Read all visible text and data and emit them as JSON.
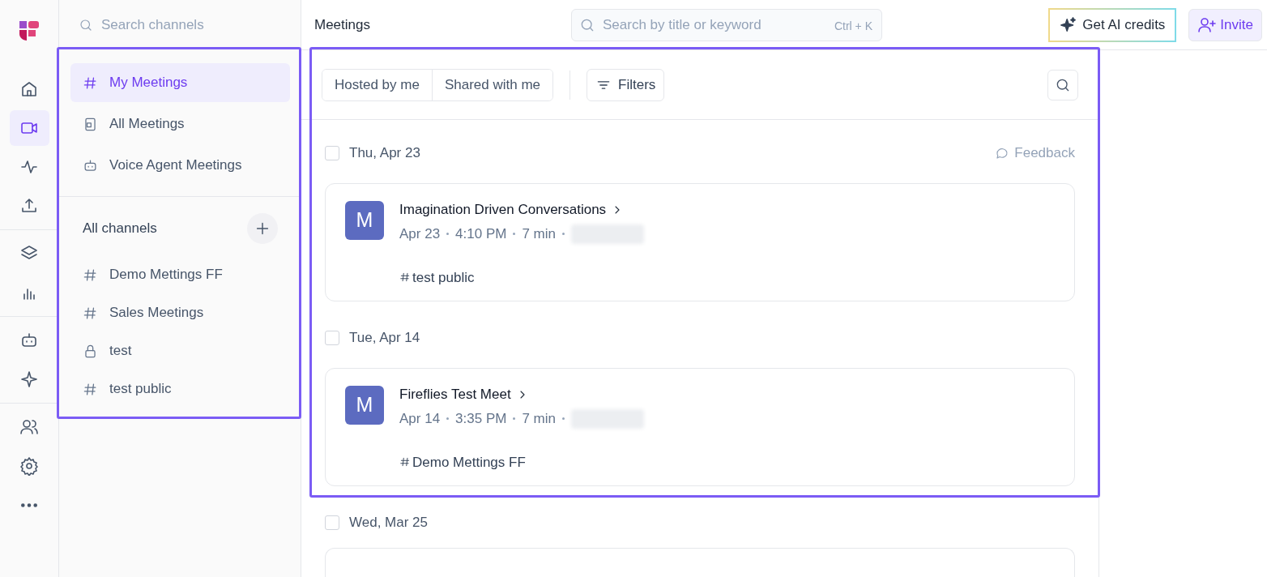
{
  "rail": [
    {
      "items": [
        {
          "kind": "home",
          "selected": false
        },
        {
          "kind": "video",
          "selected": true
        },
        {
          "kind": "activity",
          "selected": false
        },
        {
          "kind": "upload",
          "selected": false
        }
      ]
    },
    {
      "items": [
        {
          "kind": "layers",
          "selected": false
        },
        {
          "kind": "chart",
          "selected": false
        }
      ]
    },
    {
      "items": [
        {
          "kind": "bot",
          "selected": false
        },
        {
          "kind": "sparkle",
          "selected": false
        }
      ]
    },
    {
      "items": [
        {
          "kind": "users",
          "selected": false
        },
        {
          "kind": "gear",
          "selected": false
        },
        {
          "kind": "more",
          "selected": false
        }
      ]
    }
  ],
  "sidebar": {
    "search": {
      "placeholder": "Search channels"
    },
    "highlighted": true,
    "items": [
      {
        "label": "My Meetings",
        "kind": "hash",
        "selected": true
      },
      {
        "label": "All Meetings",
        "kind": "doc",
        "selected": false
      },
      {
        "label": "Voice Agent Meetings",
        "kind": "bot",
        "selected": false
      }
    ],
    "channels_heading": "All channels",
    "channels": [
      {
        "label": "Demo Mettings FF",
        "kind": "hash",
        "selected": false
      },
      {
        "label": "Sales Meetings",
        "kind": "hash",
        "selected": false
      },
      {
        "label": "test",
        "kind": "lock",
        "selected": false
      },
      {
        "label": "test public",
        "kind": "hash",
        "selected": false
      }
    ]
  },
  "header": {
    "title": "Meetings",
    "search": {
      "placeholder": "Search by title or keyword",
      "shortcut": "Ctrl + K"
    },
    "credits_button": "Get AI credits",
    "invite_button": "Invite"
  },
  "meetings": {
    "highlighted": true,
    "tabs": [
      {
        "label": "Hosted by me",
        "selected": false
      },
      {
        "label": "Shared with me",
        "selected": false
      }
    ],
    "filters_button": "Filters",
    "feedback": "Feedback",
    "groups": [
      {
        "date": "Thu, Apr 23",
        "checked": false,
        "meetings": [
          {
            "avatar": "M",
            "title": "Imagination Driven Conversations",
            "date": "Apr 23",
            "time": "4:10 PM",
            "duration": "7 min",
            "channel": "test public"
          }
        ]
      },
      {
        "date": "Tue, Apr 14",
        "checked": false,
        "meetings": [
          {
            "avatar": "M",
            "title": "Fireflies Test Meet",
            "date": "Apr 14",
            "time": "3:35 PM",
            "duration": "7 min",
            "channel": "Demo Mettings FF"
          }
        ]
      },
      {
        "date": "Wed, Mar 25",
        "checked": false
      }
    ]
  }
}
